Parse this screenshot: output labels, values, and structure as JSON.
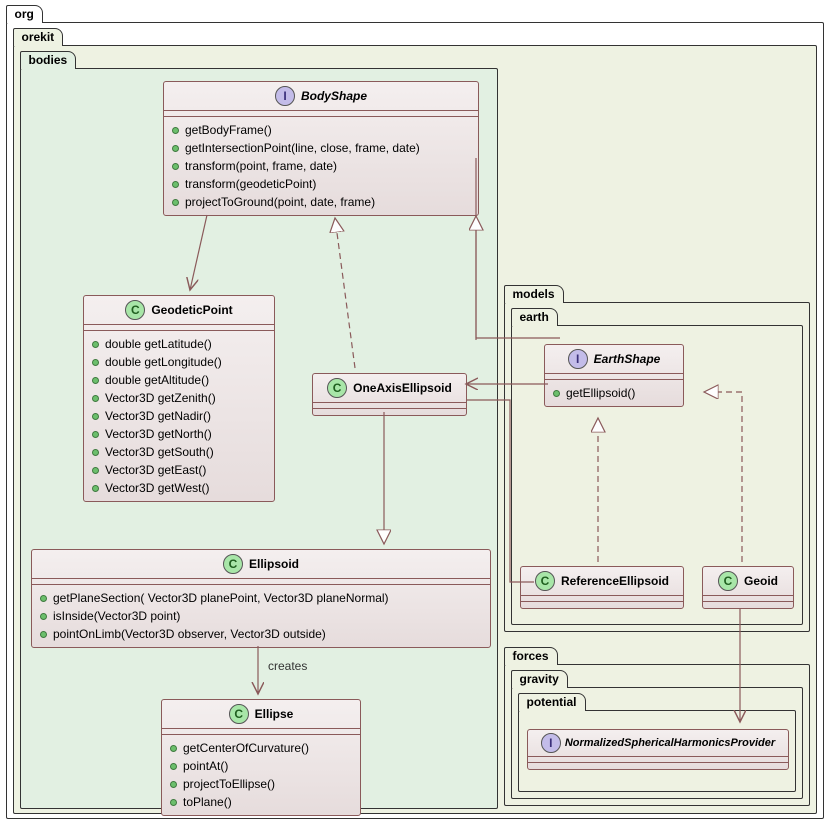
{
  "packages": {
    "org": "org",
    "orekit": "orekit",
    "bodies": "bodies",
    "models": "models",
    "earth": "earth",
    "forces": "forces",
    "gravity": "gravity",
    "potential": "potential"
  },
  "classes": {
    "BodyShape": {
      "name": "BodyShape",
      "type": "I",
      "members": [
        "getBodyFrame()",
        "getIntersectionPoint(line, close, frame, date)",
        "transform(point, frame, date)",
        "transform(geodeticPoint)",
        "projectToGround(point, date, frame)"
      ]
    },
    "GeodeticPoint": {
      "name": "GeodeticPoint",
      "type": "C",
      "members": [
        "double getLatitude()",
        "double getLongitude()",
        "double getAltitude()",
        "Vector3D getZenith()",
        "Vector3D getNadir()",
        "Vector3D getNorth()",
        "Vector3D getSouth()",
        "Vector3D getEast()",
        "Vector3D getWest()"
      ]
    },
    "OneAxisEllipsoid": {
      "name": "OneAxisEllipsoid",
      "type": "C",
      "members": []
    },
    "Ellipsoid": {
      "name": "Ellipsoid",
      "type": "C",
      "members": [
        "getPlaneSection( Vector3D planePoint, Vector3D planeNormal)",
        "isInside(Vector3D point)",
        "pointOnLimb(Vector3D observer, Vector3D outside)"
      ]
    },
    "Ellipse": {
      "name": "Ellipse",
      "type": "C",
      "members": [
        "getCenterOfCurvature()",
        "pointAt()",
        "projectToEllipse()",
        "toPlane()"
      ]
    },
    "EarthShape": {
      "name": "EarthShape",
      "type": "I",
      "members": [
        "getEllipsoid()"
      ]
    },
    "ReferenceEllipsoid": {
      "name": "ReferenceEllipsoid",
      "type": "C",
      "members": []
    },
    "Geoid": {
      "name": "Geoid",
      "type": "C",
      "members": []
    },
    "NormalizedSphericalHarmonicsProvider": {
      "name": "NormalizedSphericalHarmonicsProvider",
      "type": "I",
      "members": []
    }
  },
  "edgeLabels": {
    "creates": "creates"
  },
  "chart_data": {
    "type": "uml_class_diagram",
    "packages": [
      {
        "name": "org",
        "children": [
          "orekit"
        ]
      },
      {
        "name": "orekit",
        "children": [
          "bodies",
          "models",
          "forces"
        ]
      },
      {
        "name": "bodies",
        "classes": [
          "BodyShape",
          "GeodeticPoint",
          "OneAxisEllipsoid",
          "Ellipsoid",
          "Ellipse"
        ]
      },
      {
        "name": "models",
        "children": [
          "earth"
        ]
      },
      {
        "name": "earth",
        "classes": [
          "EarthShape",
          "ReferenceEllipsoid",
          "Geoid"
        ]
      },
      {
        "name": "forces",
        "children": [
          "gravity"
        ]
      },
      {
        "name": "gravity",
        "children": [
          "potential"
        ]
      },
      {
        "name": "potential",
        "classes": [
          "NormalizedSphericalHarmonicsProvider"
        ]
      }
    ],
    "classes": [
      {
        "name": "BodyShape",
        "stereotype": "interface",
        "package": "bodies",
        "methods": [
          "getBodyFrame()",
          "getIntersectionPoint(line, close, frame, date)",
          "transform(point, frame, date)",
          "transform(geodeticPoint)",
          "projectToGround(point, date, frame)"
        ]
      },
      {
        "name": "GeodeticPoint",
        "stereotype": "class",
        "package": "bodies",
        "methods": [
          "double getLatitude()",
          "double getLongitude()",
          "double getAltitude()",
          "Vector3D getZenith()",
          "Vector3D getNadir()",
          "Vector3D getNorth()",
          "Vector3D getSouth()",
          "Vector3D getEast()",
          "Vector3D getWest()"
        ]
      },
      {
        "name": "OneAxisEllipsoid",
        "stereotype": "class",
        "package": "bodies",
        "methods": []
      },
      {
        "name": "Ellipsoid",
        "stereotype": "class",
        "package": "bodies",
        "methods": [
          "getPlaneSection( Vector3D planePoint, Vector3D planeNormal)",
          "isInside(Vector3D point)",
          "pointOnLimb(Vector3D observer, Vector3D outside)"
        ]
      },
      {
        "name": "Ellipse",
        "stereotype": "class",
        "package": "bodies",
        "methods": [
          "getCenterOfCurvature()",
          "pointAt()",
          "projectToEllipse()",
          "toPlane()"
        ]
      },
      {
        "name": "EarthShape",
        "stereotype": "interface",
        "package": "earth",
        "methods": [
          "getEllipsoid()"
        ]
      },
      {
        "name": "ReferenceEllipsoid",
        "stereotype": "class",
        "package": "earth",
        "methods": []
      },
      {
        "name": "Geoid",
        "stereotype": "class",
        "package": "earth",
        "methods": []
      },
      {
        "name": "NormalizedSphericalHarmonicsProvider",
        "stereotype": "interface",
        "package": "potential",
        "methods": []
      }
    ],
    "relations": [
      {
        "from": "BodyShape",
        "to": "GeodeticPoint",
        "type": "association-arrow"
      },
      {
        "from": "OneAxisEllipsoid",
        "to": "BodyShape",
        "type": "realization"
      },
      {
        "from": "OneAxisEllipsoid",
        "to": "Ellipsoid",
        "type": "generalization"
      },
      {
        "from": "Ellipsoid",
        "to": "Ellipse",
        "type": "association-arrow",
        "label": "creates"
      },
      {
        "from": "EarthShape",
        "to": "BodyShape",
        "type": "generalization"
      },
      {
        "from": "EarthShape",
        "to": "OneAxisEllipsoid",
        "type": "association-arrow"
      },
      {
        "from": "ReferenceEllipsoid",
        "to": "EarthShape",
        "type": "realization"
      },
      {
        "from": "ReferenceEllipsoid",
        "to": "OneAxisEllipsoid",
        "type": "generalization"
      },
      {
        "from": "Geoid",
        "to": "EarthShape",
        "type": "realization"
      },
      {
        "from": "Geoid",
        "to": "NormalizedSphericalHarmonicsProvider",
        "type": "association-arrow"
      }
    ]
  }
}
